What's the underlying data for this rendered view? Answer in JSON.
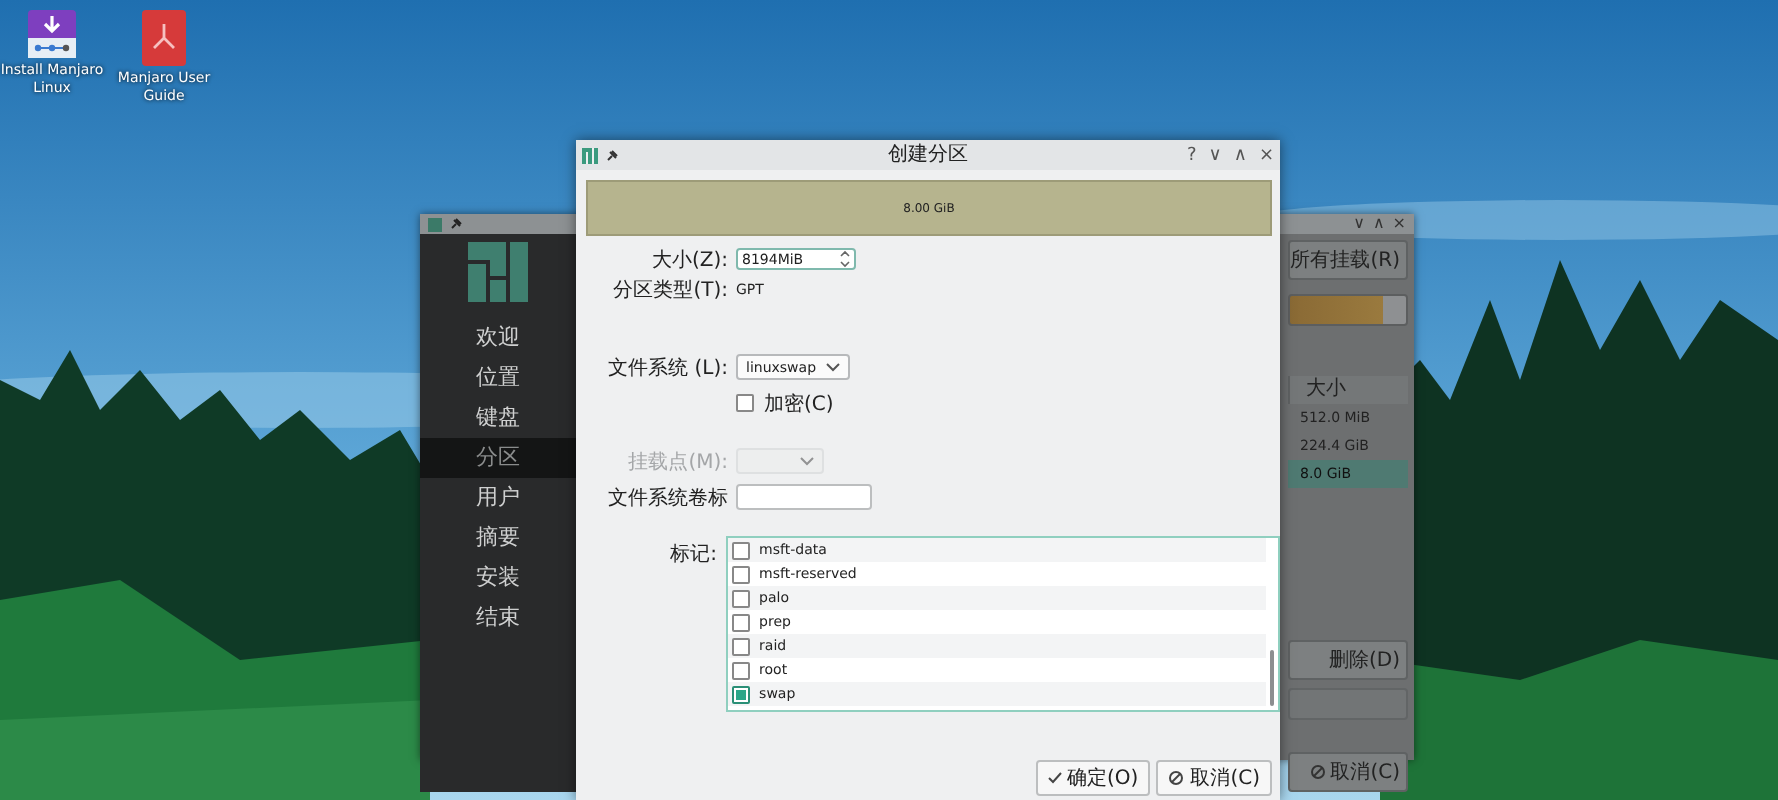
{
  "desktop_icons": [
    {
      "label": "Install Manjaro Linux",
      "kind": "installer"
    },
    {
      "label": "Manjaro User Guide",
      "kind": "guide"
    }
  ],
  "installer": {
    "window_buttons": [
      "∨",
      "∧",
      "×"
    ],
    "steps": [
      {
        "label": "欢迎",
        "selected": false
      },
      {
        "label": "位置",
        "selected": false
      },
      {
        "label": "键盘",
        "selected": false
      },
      {
        "label": "分区",
        "selected": true
      },
      {
        "label": "用户",
        "selected": false
      },
      {
        "label": "摘要",
        "selected": false
      },
      {
        "label": "安装",
        "selected": false
      },
      {
        "label": "结束",
        "selected": false
      }
    ],
    "unmount_button": "所有挂载(R)",
    "table": {
      "columns": [
        "大小"
      ],
      "rows": [
        {
          "size": "512.0 MiB",
          "selected": false
        },
        {
          "size": "224.4 GiB",
          "selected": false
        },
        {
          "size": "8.0 GiB",
          "selected": true
        }
      ]
    },
    "delete_button": "删除(D)",
    "cancel_button": "取消(C)"
  },
  "dialog": {
    "title": "创建分区",
    "window_buttons": [
      "?",
      "∨",
      "∧",
      "×"
    ],
    "free_space": "8.00 GiB",
    "size": {
      "label": "大小(Z):",
      "value": "8194MiB"
    },
    "partition_type": {
      "label": "分区类型(T):",
      "value": "GPT"
    },
    "filesystem": {
      "label": "文件系统 (L):",
      "value": "linuxswap"
    },
    "encrypt": {
      "label": "加密(C)",
      "checked": false
    },
    "mount_point": {
      "label": "挂载点(M):",
      "disabled": true
    },
    "fs_label": {
      "label": "文件系统卷标"
    },
    "flags": {
      "label": "标记:",
      "items": [
        {
          "label": "msft-data",
          "checked": false
        },
        {
          "label": "msft-reserved",
          "checked": false
        },
        {
          "label": "palo",
          "checked": false
        },
        {
          "label": "prep",
          "checked": false
        },
        {
          "label": "raid",
          "checked": false
        },
        {
          "label": "root",
          "checked": false
        },
        {
          "label": "swap",
          "checked": true
        }
      ]
    },
    "ok_button": "确定(O)",
    "cancel_button": "取消(C)"
  }
}
